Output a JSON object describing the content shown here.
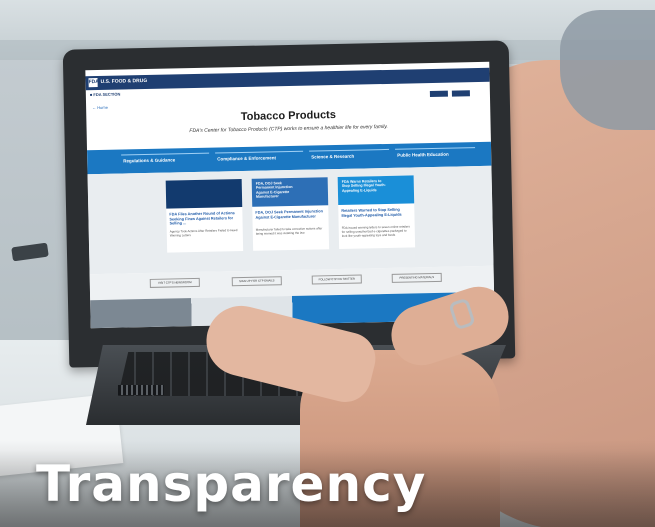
{
  "caption": "Transparency",
  "screen": {
    "agency": "U.S. FOOD & DRUG",
    "logo": "FDA",
    "section": "■ FDA SECTION",
    "home": "← Home",
    "title": "Tobacco Products",
    "subtitle": "FDA's Center for Tobacco Products (CTP) works to ensure a healthier life for every family.",
    "tabs": [
      "Regulations & Guidance",
      "Compliance & Enforcement",
      "Science & Research",
      "Public Health Education"
    ],
    "cards": [
      {
        "image_text": "",
        "title": "FDA Files Another Round of Actions Seeking Fines Against Retailers for Selling ...",
        "desc": "Agency Took Actions After Retailers Failed to Heed Warning Letters"
      },
      {
        "image_text": "FDA, DOJ Seek Permanent Injunction Against E-Cigarette Manufacturer",
        "title": "FDA, DOJ Seek Permanent Injunction Against E-Cigarette Manufacturer",
        "desc": "Manufacturer failed to take corrective actions after being warned it was violating the law"
      },
      {
        "image_text": "FDA Warns Retailers to Stop Selling Illegal Youth-Appealing E-Liquids",
        "title": "Retailers Warned to Stop Selling Illegal Youth-Appealing E-Liquids",
        "desc": "FDA issued warning letters to seven online retailers for selling unauthorized e-cigarettes packaged to look like youth-appealing toys and foods"
      }
    ],
    "links": [
      "VISIT CTP'S NEWSROOM",
      "SIGN UP FOR CTP EMAILS",
      "FOLLOW CTP ON TWITTER",
      "PRESENTING MATERIALS"
    ]
  }
}
